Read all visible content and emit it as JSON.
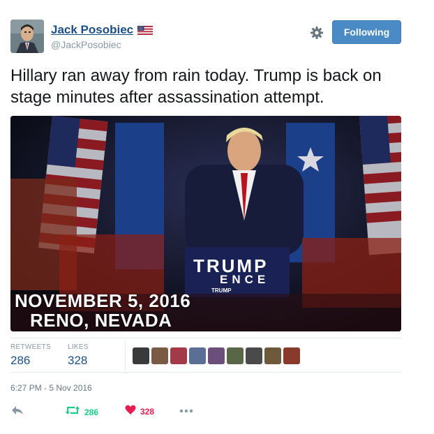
{
  "user": {
    "display_name": "Jack Posobiec",
    "handle": "@JackPosobiec",
    "flag_icon": "us-flag-icon"
  },
  "follow_button": {
    "label": "Following"
  },
  "settings_icon": "gear-icon",
  "tweet": {
    "text": "Hillary ran away from rain today. Trump is back on stage minutes after assassination attempt."
  },
  "media": {
    "overlay_date": "NOVEMBER 5, 2016",
    "overlay_place": "RENO, NEVADA",
    "podium_line1": "TRUMP",
    "podium_line2": "ENCE",
    "podium_line3": "TRUMP"
  },
  "stats": {
    "retweets_label": "RETWEETS",
    "retweets_value": "286",
    "likes_label": "LIKES",
    "likes_value": "328"
  },
  "likers": [
    {
      "color": "#3a3a3a"
    },
    {
      "color": "#7a5a44"
    },
    {
      "color": "#a33a4a"
    },
    {
      "color": "#5a6e96"
    },
    {
      "color": "#6b4e7a"
    },
    {
      "color": "#5a6648"
    },
    {
      "color": "#4a4a4a"
    },
    {
      "color": "#6e5a3a"
    },
    {
      "color": "#8a3a2a"
    }
  ],
  "timestamp": "6:27 PM - 5 Nov 2016",
  "actions": {
    "reply_icon": "reply-icon",
    "retweet_icon": "retweet-icon",
    "retweet_count": "286",
    "like_icon": "heart-icon",
    "like_count": "328",
    "more_icon": "more-icon"
  },
  "colors": {
    "link_blue": "#1b4f88",
    "follow_blue": "#4a8bc6",
    "retweet_green": "#19cf86",
    "like_red": "#e81c4f",
    "muted": "#8899a6"
  }
}
